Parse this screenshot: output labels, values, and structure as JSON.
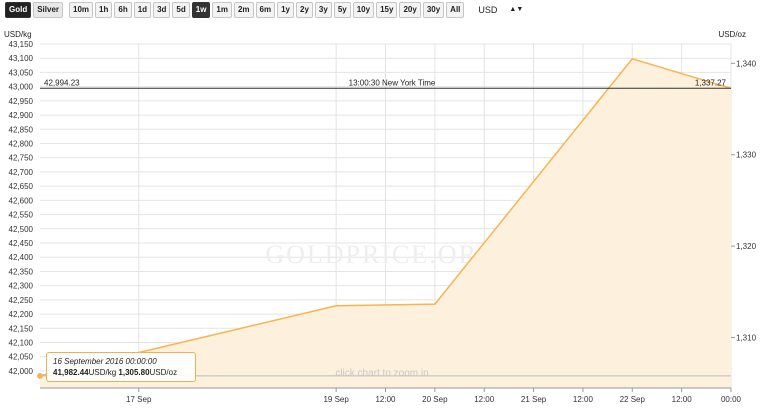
{
  "toolbar": {
    "metals": [
      {
        "label": "Gold",
        "active": true
      },
      {
        "label": "Silver",
        "active": false
      }
    ],
    "ranges": [
      {
        "label": "10m",
        "active": false
      },
      {
        "label": "1h",
        "active": false
      },
      {
        "label": "6h",
        "active": false
      },
      {
        "label": "1d",
        "active": false
      },
      {
        "label": "3d",
        "active": false
      },
      {
        "label": "5d",
        "active": false
      },
      {
        "label": "1w",
        "active": true
      },
      {
        "label": "1m",
        "active": false
      },
      {
        "label": "2m",
        "active": false
      },
      {
        "label": "6m",
        "active": false
      },
      {
        "label": "1y",
        "active": false
      },
      {
        "label": "2y",
        "active": false
      },
      {
        "label": "3y",
        "active": false
      },
      {
        "label": "5y",
        "active": false
      },
      {
        "label": "10y",
        "active": false
      },
      {
        "label": "15y",
        "active": false
      },
      {
        "label": "20y",
        "active": false
      },
      {
        "label": "30y",
        "active": false
      },
      {
        "label": "All",
        "active": false
      }
    ],
    "currency": "USD",
    "currency_caret": "▲▼"
  },
  "chart_data": {
    "type": "area",
    "left_axis_label": "USD/kg",
    "right_axis_label": "USD/oz",
    "left_ylim": [
      41940,
      43150
    ],
    "left_ticks": [
      "43,150",
      "43,100",
      "43,050",
      "43,000",
      "42,950",
      "42,900",
      "42,850",
      "42,800",
      "42,750",
      "42,700",
      "42,650",
      "42,600",
      "42,550",
      "42,500",
      "42,450",
      "42,400",
      "42,350",
      "42,300",
      "42,250",
      "42,200",
      "42,150",
      "42,100",
      "42,050",
      "42,000"
    ],
    "right_ticks": [
      "1,340",
      "1,330",
      "1,320",
      "1,310"
    ],
    "x_ticks": [
      "17 Sep",
      "19 Sep",
      "12:00",
      "20 Sep",
      "12:00",
      "21 Sep",
      "12:00",
      "22 Sep",
      "12:00",
      "00:00"
    ],
    "x_label": "",
    "series": [
      {
        "x": [
          "16 Sep 2016 00:00",
          "19 Sep 2016 00:00",
          "20 Sep 2016 00:00",
          "22 Sep 2016 00:00",
          "23 Sep 2016 00:00"
        ],
        "y": [
          41982.44,
          42229,
          42235,
          43098,
          42994.23
        ]
      }
    ],
    "current_line": {
      "left_value": "42,994.23",
      "right_value": "1,337.27",
      "label": "13:00:30 New York Time"
    },
    "watermark": "GOLDPRICE.ORG",
    "zoom_hint": "click chart to zoom in",
    "tooltip": {
      "date": "16 September 2016 00:00:00",
      "kg_value": "41,982.44",
      "kg_unit": "USD/kg",
      "oz_value": "1,305.80",
      "oz_unit": "USD/oz"
    },
    "colors": {
      "line": "#f7b44f",
      "fill": "#fdf0dc",
      "current_line": "#333333",
      "grid": "#e4e4e4"
    }
  }
}
